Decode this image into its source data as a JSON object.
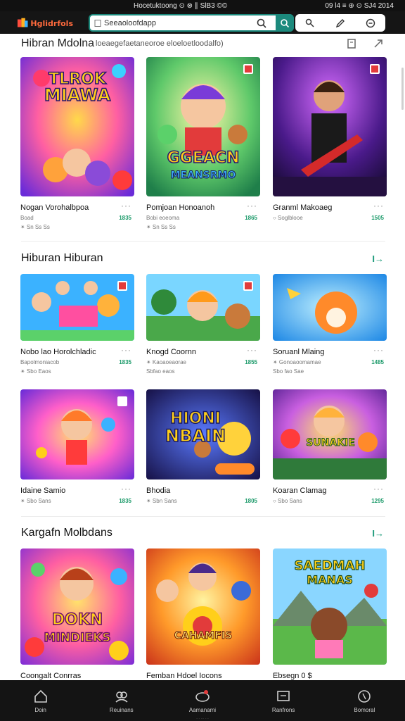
{
  "status_bar": {
    "center": "Hocetuktoong ⊙ ⊗ ∥ SlB3 ©©",
    "right": "09 l4 ≡ ⊕ ⊙ SJ4 2014"
  },
  "header": {
    "logo_text": "Hglidrfols",
    "search": {
      "value": "Seeaoloofdapp",
      "placeholder": "Seeaoloofdapp"
    },
    "icons": [
      "search-icon",
      "filter-icon",
      "edit-icon",
      "settings-icon"
    ]
  },
  "subheader": {
    "title": "Hibran Mdolna",
    "subtitle": "loeaegefaetaneoroe eloeloetloodalfo)"
  },
  "sections": [
    {
      "heading": "",
      "arrow": "",
      "cards": [
        {
          "title": "Nogan Vorohalbpoa",
          "meta1": "Boad",
          "rating": "•••",
          "meta2": "✴ Sn Ss Ss",
          "stat": "1835",
          "thumb": "pink"
        },
        {
          "title": "Pomjoan Honoanoh",
          "meta1": "Bobi eoeoma",
          "rating": "",
          "meta2": "✴ Sn Ss Ss",
          "stat": "1865",
          "thumb": "green"
        },
        {
          "title": "Granml Makoaeg",
          "meta1": "○ Soglblooe",
          "rating": "",
          "meta2": "",
          "stat": "1505",
          "thumb": "purple"
        }
      ]
    },
    {
      "heading": "Hiburan Hiburan",
      "arrow": "I→",
      "cards": [
        {
          "title": "Nobo lao Horolchladic",
          "meta1": "Bapolmoniacob",
          "rating": "",
          "meta2": "✴ Sbo Eaos",
          "stat": "1835",
          "thumb": "blue"
        },
        {
          "title": "Knogd Coornn",
          "meta1": "✴ Kaoaoeaorae",
          "rating": "",
          "meta2": "Sbfao eaos",
          "stat": "1855",
          "thumb": "forest"
        },
        {
          "title": "Soruanl Mlaing",
          "meta1": "✴ Gonoaoomamae",
          "rating": "",
          "meta2": "Sbo fao Sae",
          "stat": "1485",
          "thumb": "sky"
        }
      ]
    },
    {
      "heading": "",
      "arrow": "",
      "cards": [
        {
          "title": "Idaine Samio",
          "meta1": "",
          "rating": "",
          "meta2": "✴ Sbo Sans",
          "stat": "1835",
          "thumb": "magenta"
        },
        {
          "title": "Bhodia",
          "meta1": "",
          "rating": "",
          "meta2": "✴ Sbn Sans",
          "stat": "1805",
          "thumb": "navy"
        },
        {
          "title": "Koaran Clamag",
          "meta1": "",
          "rating": "",
          "meta2": "○ Sbo Sans",
          "stat": "1295",
          "thumb": "violet"
        }
      ]
    },
    {
      "heading": "Kargafn Molbdans",
      "arrow": "I→",
      "cards": [
        {
          "title": "Coongalt Conrras",
          "meta1": "",
          "rating": "",
          "meta2": "",
          "stat": "",
          "thumb": "candy"
        },
        {
          "title": "Femban Hdoel Iocons",
          "meta1": "",
          "rating": "",
          "meta2": "",
          "stat": "",
          "thumb": "orange"
        },
        {
          "title": "Ebsegn 0 $",
          "meta1": "",
          "rating": "",
          "meta2": "",
          "stat": "",
          "thumb": "valley"
        }
      ]
    }
  ],
  "thumb_texts": {
    "pink": "TLROK MIAWA",
    "green": "GGEACN MEANSRMO",
    "blue": "",
    "navy": "HIONI NBAIN",
    "violet": "SUNAKIE",
    "candy": "DOKN MINDIEKS",
    "orange": "CAHAMFIS",
    "valley": "SAEDMAH MANAS"
  },
  "bottom_nav": [
    {
      "label": "Doin",
      "icon": "home-icon"
    },
    {
      "label": "Reuinans",
      "icon": "people-icon"
    },
    {
      "label": "Aamanami",
      "icon": "game-icon"
    },
    {
      "label": "Ranfrons",
      "icon": "screen-icon"
    },
    {
      "label": "Bomoral",
      "icon": "profile-icon"
    }
  ],
  "gesture_text": "··· ··· ···",
  "colors": {
    "accent": "#1c8a7d",
    "stat": "#1c9a6a",
    "badge": "#e23b3b",
    "navbar": "#141414"
  }
}
